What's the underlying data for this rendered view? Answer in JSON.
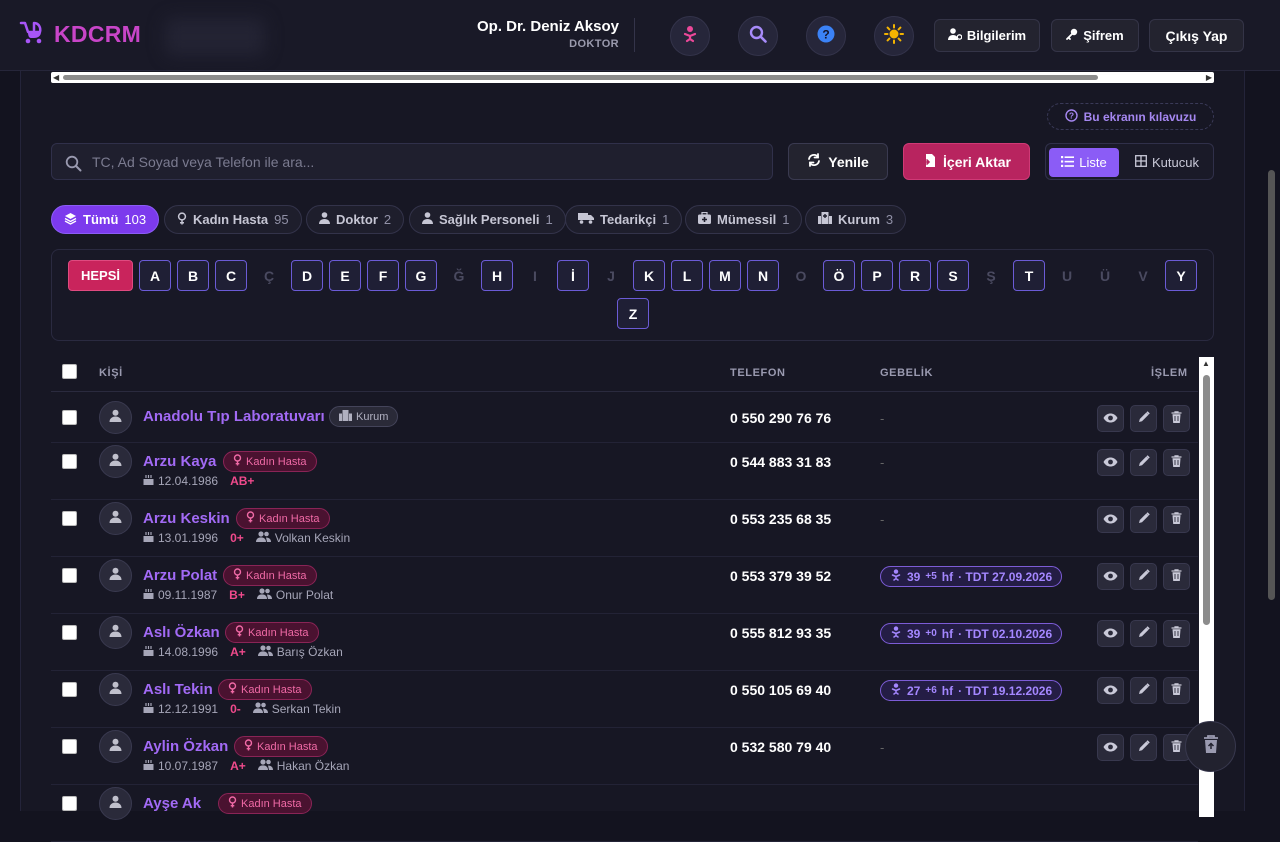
{
  "brand": {
    "name": "KDCRM"
  },
  "user": {
    "name": "Op. Dr. Deniz Aksoy",
    "role": "DOKTOR"
  },
  "header_buttons": {
    "profile": "Bilgilerim",
    "password": "Şifrem",
    "logout": "Çıkış Yap"
  },
  "guide_label": "Bu ekranın kılavuzu",
  "search": {
    "placeholder": "TC, Ad Soyad veya Telefon ile ara...",
    "value": ""
  },
  "actions": {
    "refresh": "Yenile",
    "import": "İçeri Aktar"
  },
  "view_toggle": {
    "list": "Liste",
    "grid": "Kutucuk",
    "selected": "Liste"
  },
  "filters": [
    {
      "label": "Tümü",
      "count": "103",
      "active": true
    },
    {
      "label": "Kadın Hasta",
      "count": "95"
    },
    {
      "label": "Doktor",
      "count": "2"
    },
    {
      "label": "Sağlık Personeli",
      "count": "1"
    },
    {
      "label": "Tedarikçi",
      "count": "1"
    },
    {
      "label": "Mümessil",
      "count": "1"
    },
    {
      "label": "Kurum",
      "count": "3"
    }
  ],
  "alphabet": {
    "all_label": "HEPSİ",
    "letters": [
      {
        "l": "A",
        "on": true
      },
      {
        "l": "B",
        "on": true
      },
      {
        "l": "C",
        "on": true
      },
      {
        "l": "Ç",
        "on": false
      },
      {
        "l": "D",
        "on": true
      },
      {
        "l": "E",
        "on": true
      },
      {
        "l": "F",
        "on": true
      },
      {
        "l": "G",
        "on": true
      },
      {
        "l": "Ğ",
        "on": false
      },
      {
        "l": "H",
        "on": true
      },
      {
        "l": "I",
        "on": false
      },
      {
        "l": "İ",
        "on": true
      },
      {
        "l": "J",
        "on": false
      },
      {
        "l": "K",
        "on": true
      },
      {
        "l": "L",
        "on": true
      },
      {
        "l": "M",
        "on": true
      },
      {
        "l": "N",
        "on": true
      },
      {
        "l": "O",
        "on": false
      },
      {
        "l": "Ö",
        "on": true
      },
      {
        "l": "P",
        "on": true
      },
      {
        "l": "R",
        "on": true
      },
      {
        "l": "S",
        "on": true
      },
      {
        "l": "Ş",
        "on": false
      },
      {
        "l": "T",
        "on": true
      },
      {
        "l": "U",
        "on": false
      },
      {
        "l": "Ü",
        "on": false
      },
      {
        "l": "V",
        "on": false
      },
      {
        "l": "Y",
        "on": true
      },
      {
        "l": "Z",
        "on": true
      }
    ]
  },
  "table": {
    "headers": {
      "person": "KİŞİ",
      "phone": "TELEFON",
      "pregnancy": "GEBELİK",
      "action": "İŞLEM"
    },
    "rows": [
      {
        "name": "Anadolu Tıp Laboratuvarı",
        "badge": "Kurum",
        "badge_type": "kurum",
        "phone": "0 550 290 76 76",
        "pregnancy": "-"
      },
      {
        "name": "Arzu Kaya",
        "badge": "Kadın Hasta",
        "badge_type": "kadin",
        "birth": "12.04.1986",
        "blood": "AB+",
        "spouse": "",
        "phone": "0 544 883 31 83",
        "pregnancy": "-"
      },
      {
        "name": "Arzu Keskin",
        "badge": "Kadın Hasta",
        "badge_type": "kadin",
        "birth": "13.01.1996",
        "blood": "0+",
        "spouse": "Volkan Keskin",
        "phone": "0 553 235 68 35",
        "pregnancy": "-"
      },
      {
        "name": "Arzu Polat",
        "badge": "Kadın Hasta",
        "badge_type": "kadin",
        "birth": "09.11.1987",
        "blood": "B+",
        "spouse": "Onur Polat",
        "phone": "0 553 379 39 52",
        "preg_weeks": "39",
        "preg_days": "+5",
        "preg_unit": "hf",
        "preg_due": "· TDT 27.09.2026"
      },
      {
        "name": "Aslı Özkan",
        "badge": "Kadın Hasta",
        "badge_type": "kadin",
        "birth": "14.08.1996",
        "blood": "A+",
        "spouse": "Barış Özkan",
        "phone": "0 555 812 93 35",
        "preg_weeks": "39",
        "preg_days": "+0",
        "preg_unit": "hf",
        "preg_due": "· TDT 02.10.2026"
      },
      {
        "name": "Aslı Tekin",
        "badge": "Kadın Hasta",
        "badge_type": "kadin",
        "birth": "12.12.1991",
        "blood": "0-",
        "spouse": "Serkan Tekin",
        "phone": "0 550 105 69 40",
        "preg_weeks": "27",
        "preg_days": "+6",
        "preg_unit": "hf",
        "preg_due": "· TDT 19.12.2026"
      },
      {
        "name": "Aylin Özkan",
        "badge": "Kadın Hasta",
        "badge_type": "kadin",
        "birth": "10.07.1987",
        "blood": "A+",
        "spouse": "Hakan Özkan",
        "phone": "0 532 580 79 40",
        "pregnancy": "-"
      },
      {
        "name": "Ayşe Ak",
        "badge": "Kadın Hasta",
        "badge_type": "kadin",
        "birth": "",
        "blood": "",
        "spouse": "",
        "phone": "",
        "pregnancy": ""
      }
    ]
  },
  "colors": {
    "accent": "#7c3aed",
    "import": "#b8245f",
    "brand": "#c845c8"
  }
}
